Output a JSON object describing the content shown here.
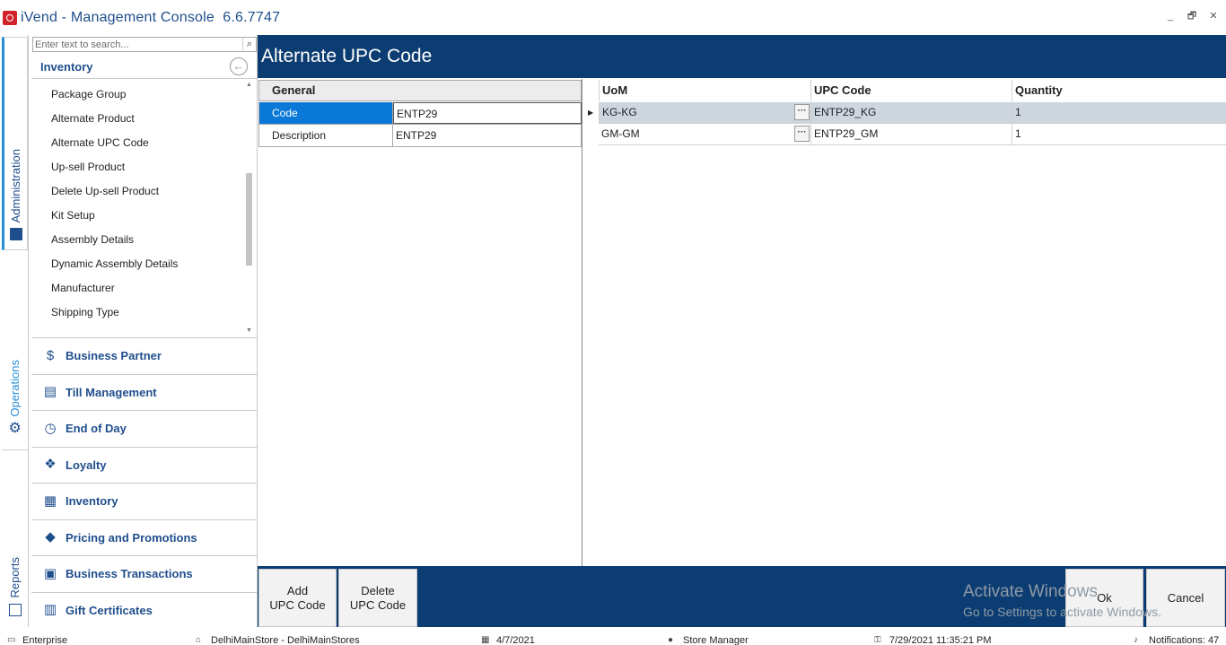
{
  "window": {
    "title": "iVend - Management Console",
    "version": "6.6.7747",
    "controls": [
      "_",
      "🗗",
      "✕"
    ]
  },
  "vertical_tabs": [
    {
      "label": "Administration",
      "icon": "admin-icon"
    },
    {
      "label": "Operations",
      "icon": "gear-icon"
    },
    {
      "label": "Reports",
      "icon": "reports-icon"
    }
  ],
  "nav": {
    "search_placeholder": "Enter text to search...",
    "section_title": "Inventory",
    "subitems": [
      "Package Group",
      "Alternate Product",
      "Alternate UPC Code",
      "Up-sell Product",
      "Delete Up-sell Product",
      "Kit Setup",
      "Assembly Details",
      "Dynamic Assembly Details",
      "Manufacturer",
      "Shipping Type"
    ],
    "modules": [
      {
        "label": "Business Partner",
        "icon": "business-partner-icon",
        "glyph": "$"
      },
      {
        "label": "Till Management",
        "icon": "till-icon",
        "glyph": "▤"
      },
      {
        "label": "End of Day",
        "icon": "clock-icon",
        "glyph": "◷"
      },
      {
        "label": "Loyalty",
        "icon": "gift-icon",
        "glyph": "❖"
      },
      {
        "label": "Inventory",
        "icon": "warehouse-icon",
        "glyph": "▦"
      },
      {
        "label": "Pricing and Promotions",
        "icon": "tag-icon",
        "glyph": "◆"
      },
      {
        "label": "Business Transactions",
        "icon": "transactions-icon",
        "glyph": "▣"
      },
      {
        "label": "Gift Certificates",
        "icon": "certificate-icon",
        "glyph": "▥"
      }
    ]
  },
  "main": {
    "title": "Alternate UPC Code",
    "properties": {
      "category": "General",
      "rows": [
        {
          "name": "Code",
          "value": "ENTP29"
        },
        {
          "name": "Description",
          "value": "ENTP29"
        }
      ]
    },
    "grid": {
      "columns": [
        "UoM",
        "UPC Code",
        "Quantity"
      ],
      "rows": [
        {
          "uom": "KG-KG",
          "upc": "ENTP29_KG",
          "qty": "1"
        },
        {
          "uom": "GM-GM",
          "upc": "ENTP29_GM",
          "qty": "1"
        }
      ]
    }
  },
  "actions": {
    "add_line1": "Add",
    "add_line2": "UPC Code",
    "delete_line1": "Delete",
    "delete_line2": "UPC Code",
    "ok": "Ok",
    "cancel": "Cancel"
  },
  "watermark": {
    "line1": "Activate Windows",
    "line2": "Go to Settings to activate Windows."
  },
  "status": {
    "edition": "Enterprise",
    "store": "DelhiMainStore - DelhiMainStores",
    "date": "4/7/2021",
    "role": "Store Manager",
    "datetime": "7/29/2021 11:35:21 PM",
    "notifications": "Notifications: 47"
  }
}
